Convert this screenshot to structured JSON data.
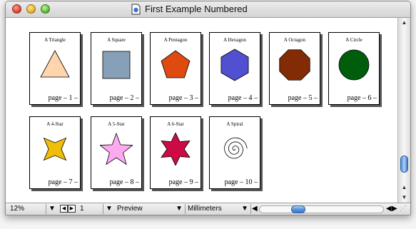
{
  "window": {
    "title": "First Example Numbered"
  },
  "pages": [
    {
      "name": "A Triangle",
      "number": "page – 1 –",
      "shape": "triangle",
      "fill": "#ffd5ad"
    },
    {
      "name": "A Square",
      "number": "page – 2 –",
      "shape": "square",
      "fill": "#86a0b8"
    },
    {
      "name": "A Pentagon",
      "number": "page – 3 –",
      "shape": "pentagon",
      "fill": "#de4a0f"
    },
    {
      "name": "A Hexagon",
      "number": "page – 4 –",
      "shape": "hexagon",
      "fill": "#5050d0"
    },
    {
      "name": "A Octagon",
      "number": "page – 5 –",
      "shape": "octagon",
      "fill": "#822b05"
    },
    {
      "name": "A Circle",
      "number": "page – 6 –",
      "shape": "circle",
      "fill": "#005d0c"
    },
    {
      "name": "A 4-Star",
      "number": "page – 7 –",
      "shape": "star4",
      "fill": "#f0bd08"
    },
    {
      "name": "A 5-Star",
      "number": "page – 8 –",
      "shape": "star5",
      "fill": "#ffaaf0"
    },
    {
      "name": "A 6-Star",
      "number": "page – 9 –",
      "shape": "star6",
      "fill": "#cc0a45"
    },
    {
      "name": "A Spiral",
      "number": "page – 10 –",
      "shape": "spiral",
      "fill": "none"
    }
  ],
  "statusbar": {
    "zoom": "12%",
    "page_field": "1",
    "view_mode": "Preview",
    "units": "Millimeters"
  }
}
